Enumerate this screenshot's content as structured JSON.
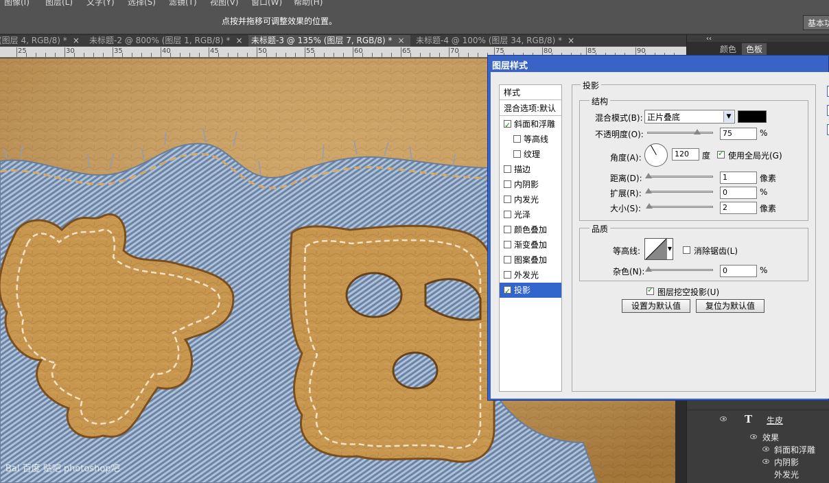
{
  "menubar": {
    "items": [
      "图像(I)",
      "图层(L)",
      "文字(Y)",
      "选择(S)",
      "滤镜(T)",
      "视图(V)",
      "窗口(W)",
      "帮助(H)"
    ]
  },
  "options": {
    "hint": "点按并拖移可调整效果的位置。",
    "workspace": "基本功能"
  },
  "tabs": [
    {
      "label": "(图层 4, RGB/8) *"
    },
    {
      "label": "未标题-2 @ 800% (图层 1, RGB/8) *"
    },
    {
      "label": "未标题-3 @ 135% (图层 7, RGB/8) *"
    },
    {
      "label": "未标题-4 @ 100% (图层 34, RGB/8) *"
    }
  ],
  "ruler": {
    "ticks": [
      "25",
      "30",
      "35",
      "40",
      "45",
      "50",
      "55",
      "60",
      "65",
      "70",
      "75",
      "80",
      "85",
      "90"
    ]
  },
  "panels": {
    "tabs": [
      "颜色",
      "色板"
    ],
    "layer": {
      "name": "生皮",
      "effects_label": "效果",
      "effects": [
        "斜面和浮雕",
        "内阴影",
        "外发光"
      ]
    }
  },
  "watermark": "Bai 百度 贴吧   photoshop吧",
  "dialog": {
    "title": "图层样式",
    "styles_header": "样式",
    "blend_header": "混合选项:默认",
    "styles": [
      {
        "label": "斜面和浮雕",
        "checked": true,
        "indent": false,
        "selected": false
      },
      {
        "label": "等高线",
        "checked": false,
        "indent": true,
        "selected": false
      },
      {
        "label": "纹理",
        "checked": false,
        "indent": true,
        "selected": false
      },
      {
        "label": "描边",
        "checked": false,
        "indent": false,
        "selected": false
      },
      {
        "label": "内阴影",
        "checked": false,
        "indent": false,
        "selected": false
      },
      {
        "label": "内发光",
        "checked": false,
        "indent": false,
        "selected": false
      },
      {
        "label": "光泽",
        "checked": false,
        "indent": false,
        "selected": false
      },
      {
        "label": "颜色叠加",
        "checked": false,
        "indent": false,
        "selected": false
      },
      {
        "label": "渐变叠加",
        "checked": false,
        "indent": false,
        "selected": false
      },
      {
        "label": "图案叠加",
        "checked": false,
        "indent": false,
        "selected": false
      },
      {
        "label": "外发光",
        "checked": false,
        "indent": false,
        "selected": false
      },
      {
        "label": "投影",
        "checked": true,
        "indent": false,
        "selected": true
      }
    ],
    "section_title": "投影",
    "structure": {
      "title": "结构",
      "blend_mode_label": "混合模式(B):",
      "blend_mode_value": "正片叠底",
      "shadow_color": "#000000",
      "opacity_label": "不透明度(O):",
      "opacity_value": "75",
      "opacity_fraction": 0.75,
      "percent": "%",
      "angle_label": "角度(A):",
      "angle_value": "120",
      "degree": "度",
      "global_light_label": "使用全局光(G)",
      "global_light": true,
      "distance_label": "距离(D):",
      "distance_value": "1",
      "spread_label": "扩展(R):",
      "spread_value": "0",
      "size_label": "大小(S):",
      "size_value": "2",
      "px": "像素"
    },
    "quality": {
      "title": "品质",
      "contour_label": "等高线:",
      "antialias_label": "消除锯齿(L)",
      "antialias": false,
      "noise_label": "杂色(N):",
      "noise_value": "0",
      "percent": "%"
    },
    "knockout_label": "图层挖空投影(U)",
    "knockout": true,
    "make_default": "设置为默认值",
    "reset_default": "复位为默认值"
  }
}
